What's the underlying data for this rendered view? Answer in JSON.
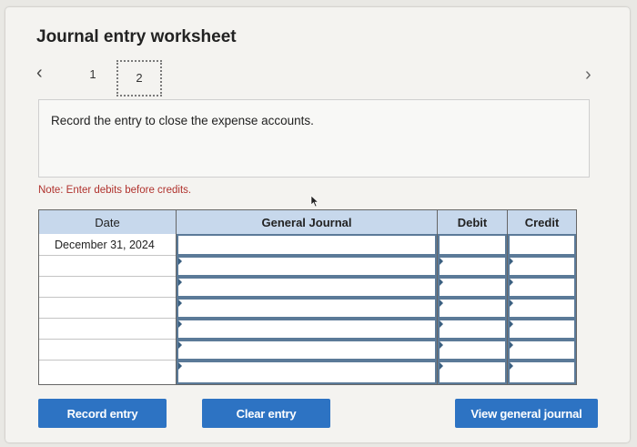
{
  "title": "Journal entry worksheet",
  "pagination": {
    "prev_icon": "‹",
    "next_icon": "›",
    "pages": [
      "1",
      "2"
    ],
    "current": "2"
  },
  "instruction": "Record the entry to close the expense accounts.",
  "note": "Note: Enter debits before credits.",
  "table": {
    "headers": {
      "date": "Date",
      "general_journal": "General Journal",
      "debit": "Debit",
      "credit": "Credit"
    },
    "rows": [
      {
        "date": "December 31, 2024",
        "account": "",
        "debit": "",
        "credit": ""
      },
      {
        "date": "",
        "account": "",
        "debit": "",
        "credit": ""
      },
      {
        "date": "",
        "account": "",
        "debit": "",
        "credit": ""
      },
      {
        "date": "",
        "account": "",
        "debit": "",
        "credit": ""
      },
      {
        "date": "",
        "account": "",
        "debit": "",
        "credit": ""
      },
      {
        "date": "",
        "account": "",
        "debit": "",
        "credit": ""
      },
      {
        "date": "",
        "account": "",
        "debit": "",
        "credit": ""
      }
    ]
  },
  "buttons": {
    "record": "Record entry",
    "clear": "Clear entry",
    "view": "View general journal"
  },
  "colors": {
    "accent": "#2d73c3",
    "header_bg": "#c7d8ec",
    "note": "#b0322d"
  }
}
